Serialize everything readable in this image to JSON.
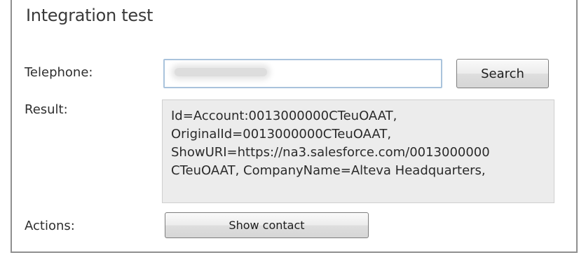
{
  "panel": {
    "title": "Integration test"
  },
  "form": {
    "telephone_label": "Telephone:",
    "telephone_value": "",
    "search_label": "Search",
    "result_label": "Result:",
    "result_text": "Id=Account:0013000000CTeuOAAT,\nOriginalId=0013000000CTeuOAAT,\nShowURI=https://na3.salesforce.com/0013000000\nCTeuOAAT, CompanyName=Alteva Headquarters,",
    "actions_label": "Actions:",
    "show_contact_label": "Show contact"
  }
}
